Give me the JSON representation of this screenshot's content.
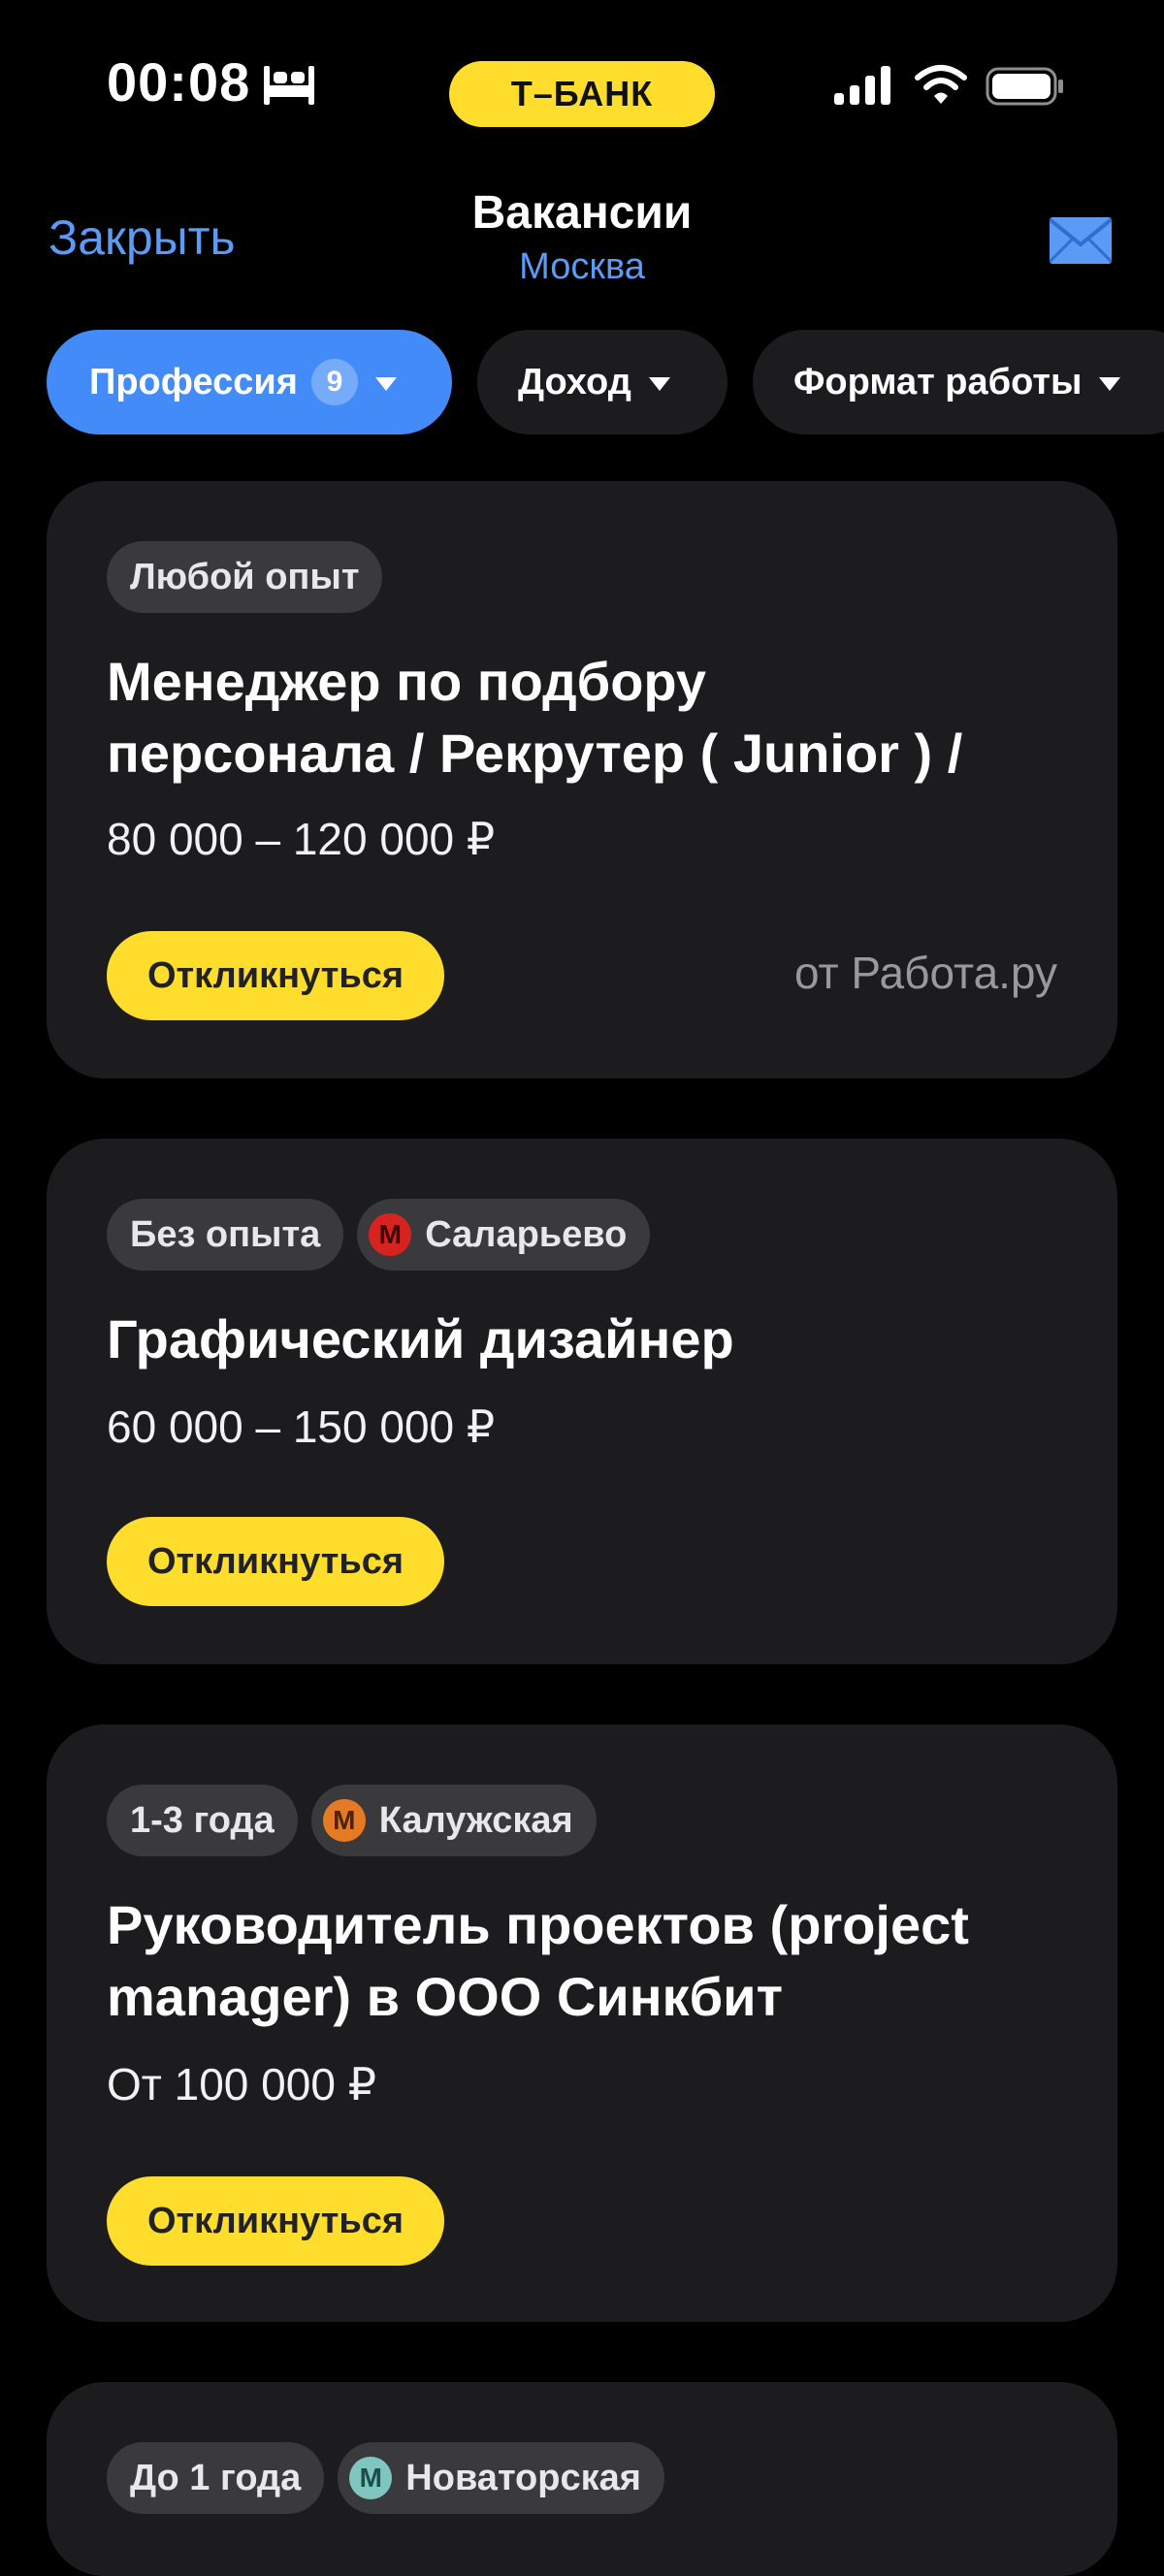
{
  "status_bar": {
    "time": "00:08",
    "bank_label": "Т–БАНК",
    "icons": [
      "bed-icon",
      "signal-icon",
      "wifi-icon",
      "battery-icon"
    ]
  },
  "header": {
    "close_label": "Закрыть",
    "title": "Вакансии",
    "subtitle": "Москва",
    "mail_icon": "mail-icon"
  },
  "filters": [
    {
      "label": "Профессия",
      "count": "9",
      "active": true
    },
    {
      "label": "Доход",
      "active": false
    },
    {
      "label": "Формат работы",
      "active": false
    }
  ],
  "vacancies": [
    {
      "tags": [
        "Любой опыт"
      ],
      "title_lines": [
        "Менеджер по подбору",
        "персонала / Рекрутер ( Junior ) / "
      ],
      "salary": "80 000 – 120 000 ₽",
      "apply_label": "Откликнуться",
      "source": "от Работа.ру"
    },
    {
      "tags": [
        "Без опыта"
      ],
      "metro": {
        "letter": "М",
        "station": "Саларьево",
        "color": "#d6231f"
      },
      "title_lines": [
        "Графический дизайнер"
      ],
      "salary": "60 000 – 150 000 ₽",
      "apply_label": "Откликнуться"
    },
    {
      "tags": [
        "1-3 года"
      ],
      "metro": {
        "letter": "М",
        "station": "Калужская",
        "color": "#e57a25"
      },
      "title_lines": [
        "Руководитель проектов (project",
        "manager) в ООО Синкбит"
      ],
      "salary": "От 100 000 ₽",
      "apply_label": "Откликнуться"
    },
    {
      "tags": [
        "До 1 года"
      ],
      "metro": {
        "letter": "М",
        "station": "Новаторская",
        "color": "#7fc6c0"
      }
    }
  ],
  "colors": {
    "accent_blue": "#428bf9",
    "link_blue": "#5b9bf5",
    "brand_yellow": "#ffdd2d",
    "card_bg": "#1c1c1e",
    "tag_bg": "#3a3a3c"
  }
}
